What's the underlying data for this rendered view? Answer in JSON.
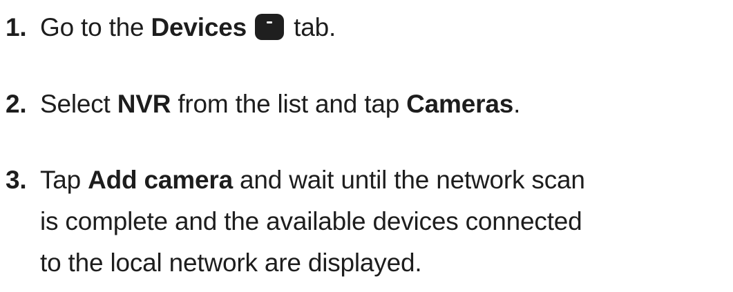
{
  "steps": [
    {
      "number": "1.",
      "parts": {
        "a": "Go to the ",
        "b": "Devices",
        "c": " tab."
      },
      "icon": "devices-tab-icon"
    },
    {
      "number": "2.",
      "parts": {
        "a": "Select ",
        "b": "NVR",
        "c": " from the list and tap ",
        "d": "Cameras",
        "e": "."
      }
    },
    {
      "number": "3.",
      "parts": {
        "a": "Tap ",
        "b": "Add camera",
        "c": " and wait until the network scan",
        "d": "is complete and the available devices connected",
        "e": "to the local network are displayed."
      }
    }
  ]
}
